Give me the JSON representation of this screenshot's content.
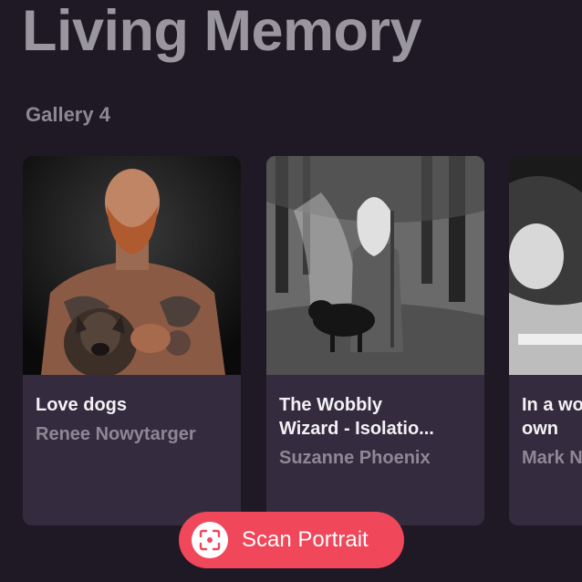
{
  "header": {
    "title": "Living Memory"
  },
  "gallery": {
    "label": "Gallery 4",
    "cards": [
      {
        "title": "Love dogs",
        "author": "Renee Nowytarger"
      },
      {
        "title": "The Wobbly\nWizard - Isolatio...",
        "author": "Suzanne Phoenix"
      },
      {
        "title": "In a wo\nown",
        "author": "Mark N"
      }
    ]
  },
  "actions": {
    "scan_label": "Scan Portrait",
    "scan_icon": "scan-frame-icon",
    "accent_color": "#f0475a"
  }
}
